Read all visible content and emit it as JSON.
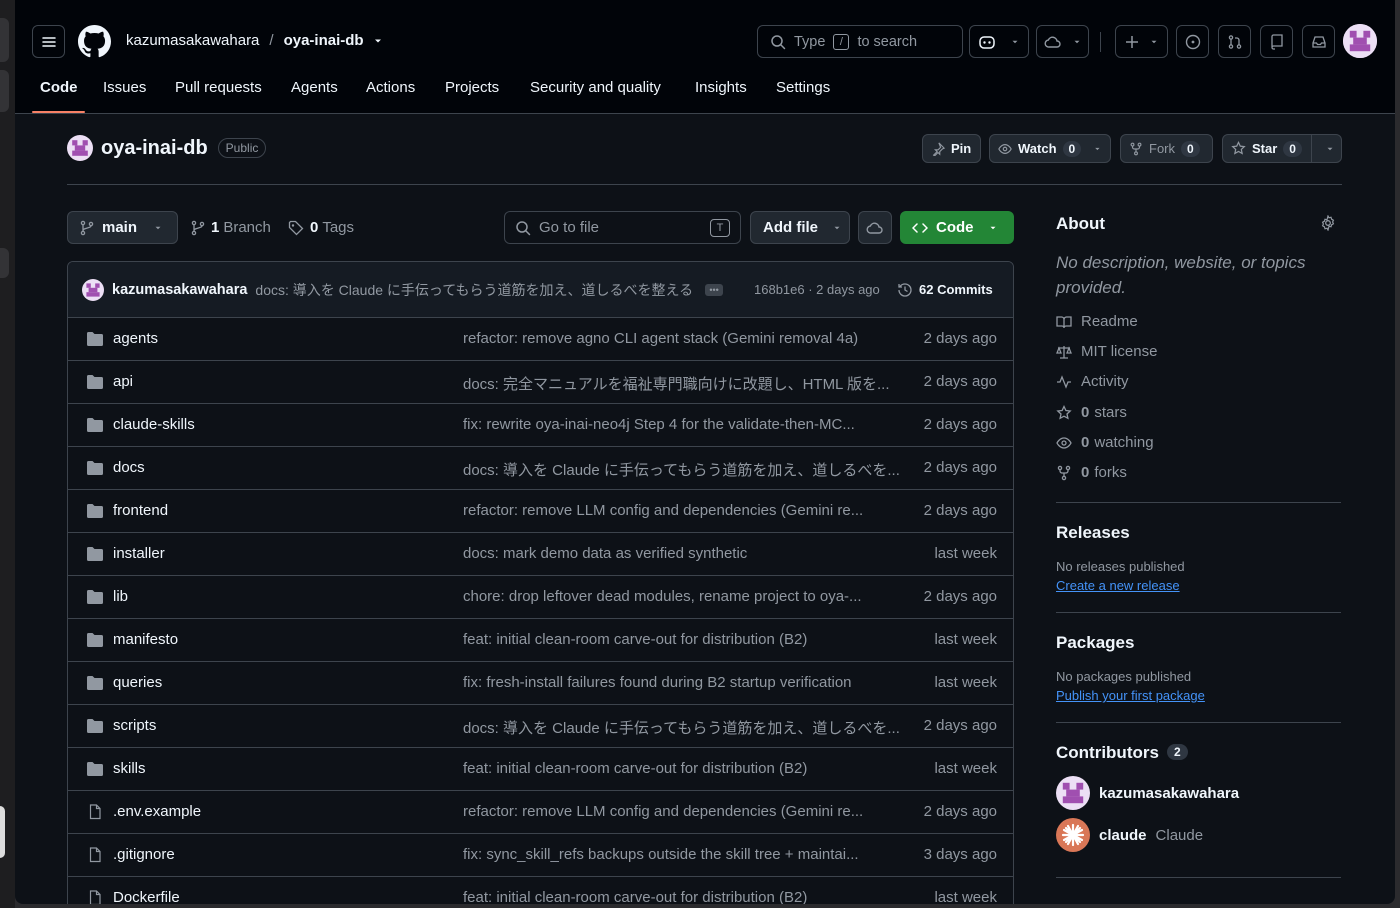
{
  "header": {
    "owner": "kazumasakawahara",
    "separator": "/",
    "repo": "oya-inai-db",
    "search_pre": "Type",
    "search_key": "/",
    "search_post": "to search"
  },
  "tabs": [
    "Code",
    "Issues",
    "Pull requests",
    "Agents",
    "Actions",
    "Projects",
    "Security and quality",
    "Insights",
    "Settings"
  ],
  "repo": {
    "name": "oya-inai-db",
    "visibility": "Public",
    "pin_label": "Pin",
    "watch_label": "Watch",
    "watch_count": "0",
    "fork_label": "Fork",
    "fork_count": "0",
    "star_label": "Star",
    "star_count": "0"
  },
  "controls": {
    "branch": "main",
    "branch_count": "1",
    "branch_label": "Branch",
    "tag_count": "0",
    "tag_label": "Tags",
    "goto_placeholder": "Go to file",
    "goto_key": "T",
    "add_file": "Add file",
    "code": "Code"
  },
  "last_commit": {
    "author": "kazumasakawahara",
    "message": "docs: 導入を Claude に手伝ってもらう道筋を加え、道しるべを整える",
    "sha_time": "168b1e6 · 2 days ago",
    "commits": "62 Commits"
  },
  "files": [
    {
      "name": "agents",
      "type": "dir",
      "message": "refactor: remove agno CLI agent stack (Gemini removal 4a)",
      "age": "2 days ago"
    },
    {
      "name": "api",
      "type": "dir",
      "message": "docs: 完全マニュアルを福祉専門職向けに改題し、HTML 版を...",
      "age": "2 days ago"
    },
    {
      "name": "claude-skills",
      "type": "dir",
      "message": "fix: rewrite oya-inai-neo4j Step 4 for the validate-then-MC...",
      "age": "2 days ago"
    },
    {
      "name": "docs",
      "type": "dir",
      "message": "docs: 導入を Claude に手伝ってもらう道筋を加え、道しるべを...",
      "age": "2 days ago"
    },
    {
      "name": "frontend",
      "type": "dir",
      "message": "refactor: remove LLM config and dependencies (Gemini re...",
      "age": "2 days ago"
    },
    {
      "name": "installer",
      "type": "dir",
      "message": "docs: mark demo data as verified synthetic",
      "age": "last week"
    },
    {
      "name": "lib",
      "type": "dir",
      "message": "chore: drop leftover dead modules, rename project to oya-...",
      "age": "2 days ago"
    },
    {
      "name": "manifesto",
      "type": "dir",
      "message": "feat: initial clean-room carve-out for distribution (B2)",
      "age": "last week"
    },
    {
      "name": "queries",
      "type": "dir",
      "message": "fix: fresh-install failures found during B2 startup verification",
      "age": "last week"
    },
    {
      "name": "scripts",
      "type": "dir",
      "message": "docs: 導入を Claude に手伝ってもらう道筋を加え、道しるべを...",
      "age": "2 days ago"
    },
    {
      "name": "skills",
      "type": "dir",
      "message": "feat: initial clean-room carve-out for distribution (B2)",
      "age": "last week"
    },
    {
      "name": ".env.example",
      "type": "file",
      "message": "refactor: remove LLM config and dependencies (Gemini re...",
      "age": "2 days ago"
    },
    {
      "name": ".gitignore",
      "type": "file",
      "message": "fix: sync_skill_refs backups outside the skill tree + maintai...",
      "age": "3 days ago"
    },
    {
      "name": "Dockerfile",
      "type": "file",
      "message": "feat: initial clean-room carve-out for distribution (B2)",
      "age": "last week"
    }
  ],
  "about": {
    "title": "About",
    "description": "No description, website, or topics provided.",
    "readme": "Readme",
    "license": "MIT license",
    "activity": "Activity",
    "stars_count": "0",
    "stars_label": "stars",
    "watching_count": "0",
    "watching_label": "watching",
    "forks_count": "0",
    "forks_label": "forks"
  },
  "releases": {
    "title": "Releases",
    "sub": "No releases published",
    "link": "Create a new release"
  },
  "packages": {
    "title": "Packages",
    "sub": "No packages published",
    "link": "Publish your first package"
  },
  "contributors": {
    "title": "Contributors",
    "count": "2",
    "list": [
      {
        "login": "kazumasakawahara",
        "name": ""
      },
      {
        "login": "claude",
        "name": "Claude"
      }
    ]
  },
  "colors": {
    "background": "#0d1117",
    "accent_underline": "#f78166",
    "code_button": "#238636",
    "link": "#4493f8"
  }
}
